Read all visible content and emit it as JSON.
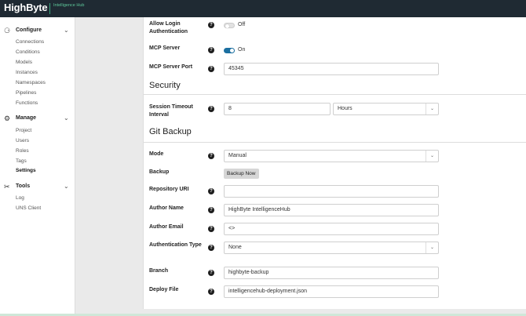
{
  "app": {
    "logo": "HighByte",
    "logo_sub": "Intelligence Hub"
  },
  "sidebar": {
    "configure": {
      "label": "Configure",
      "items": [
        "Connections",
        "Conditions",
        "Models",
        "Instances",
        "Namespaces",
        "Pipelines",
        "Functions"
      ]
    },
    "manage": {
      "label": "Manage",
      "items": [
        "Project",
        "Users",
        "Roles",
        "Tags",
        "Settings"
      ]
    },
    "tools": {
      "label": "Tools",
      "items": [
        "Log",
        "UNS Client"
      ]
    }
  },
  "form": {
    "allow_login": {
      "label": "Allow Login Authentication",
      "state": "Off"
    },
    "mcp_server": {
      "label": "MCP Server",
      "state": "On"
    },
    "mcp_port": {
      "label": "MCP Server Port",
      "value": "45345"
    },
    "security_title": "Security",
    "session_timeout": {
      "label": "Session Timeout Interval",
      "value": "8",
      "unit": "Hours"
    },
    "git_title": "Git Backup",
    "mode": {
      "label": "Mode",
      "value": "Manual"
    },
    "backup": {
      "label": "Backup",
      "button": "Backup Now"
    },
    "repo_uri": {
      "label": "Repository URI",
      "value": ""
    },
    "author_name": {
      "label": "Author Name",
      "value": "HighByte IntelligenceHub"
    },
    "author_email": {
      "label": "Author Email",
      "value": "<>"
    },
    "auth_type": {
      "label": "Authentication Type",
      "value": "None"
    },
    "branch": {
      "label": "Branch",
      "value": "highbyte-backup"
    },
    "deploy_file": {
      "label": "Deploy File",
      "value": "intelligencehub-deployment.json"
    }
  },
  "colors": {
    "topbar": "#1f2a33",
    "accent": "#1b6fa0",
    "logo_accent": "#5ec79a"
  }
}
